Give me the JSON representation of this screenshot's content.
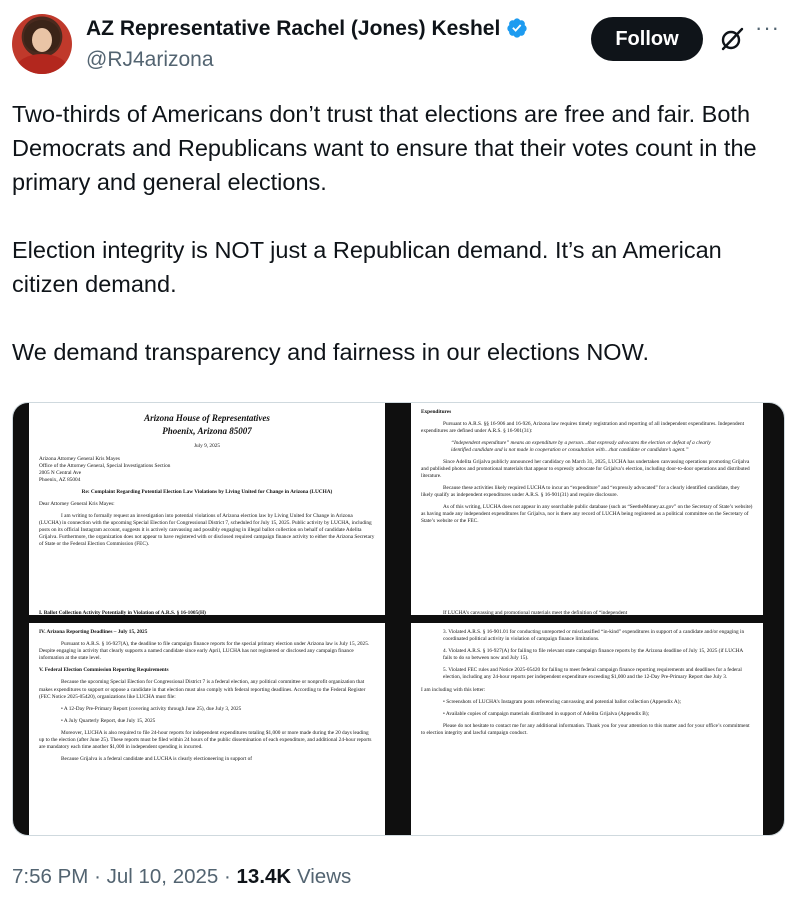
{
  "author": {
    "name": "AZ Representative Rachel (Jones) Keshel",
    "handle": "@RJ4arizona"
  },
  "actions": {
    "follow_label": "Follow"
  },
  "post": {
    "paragraphs": [
      "Two-thirds of Americans don’t trust that elections are free and fair. Both Democrats and Republicans want to ensure that their votes count in the primary and general elections.",
      "Election integrity is NOT just a Republican demand. It’s an American citizen demand.",
      "We demand transparency and fairness in our elections NOW."
    ]
  },
  "letter": {
    "p1": {
      "house": "Arizona House of Representatives",
      "city": "Phoenix, Arizona 85007",
      "date": "July 9, 2025",
      "address": [
        "Arizona Attorney General Kris Mayes",
        "Office of the Attorney General, Special Investigations Section",
        "2005 N Central Ave",
        "Phoenix, AZ 85004"
      ],
      "re": "Re: Complaint Regarding Potential Election Law Violations by Living United for Change in Arizona (LUCHA)",
      "salutation": "Dear Attorney General Kris Mayes:",
      "body": "I am writing to formally request an investigation into potential violations of Arizona election law by Living United for Change in Arizona (LUCHA) in connection with the upcoming Special Election for Congressional District 7, scheduled for July 15, 2025. Public activity by LUCHA, including posts on its official Instagram account, suggests it is actively canvassing and possibly engaging in illegal ballot collection on behalf of candidate Adelita Grijalva. Furthermore, the organization does not appear to have registered with or disclosed required campaign finance activity to either the Arizona Secretary of State or the Federal Election Commission (FEC).",
      "cut": "I. Ballot Collection Activity Potentially in Violation of A.R.S. § 16-1005(H)"
    },
    "p2": {
      "heading": "Expenditures",
      "para1": "Pursuant to A.R.S. §§ 16-906 and 16-926, Arizona law requires timely registration and reporting of all independent expenditures. Independent expenditures are defined under A.R.S. § 16-901(31):",
      "quote": "“Independent expenditure” means an expenditure by a person…that expressly advocates the election or defeat of a clearly identified candidate and is not made in cooperation or consultation with…that candidate or candidate’s agent.”",
      "para2": "Since Adelita Grijalva publicly announced her candidacy on March 31, 2025, LUCHA has undertaken canvassing operations promoting Grijalva and published photos and promotional materials that appear to expressly advocate for Grijalva’s election, including door-to-door operations and distributed literature.",
      "para3": "Because these activities likely required LUCHA to incur an “expenditure” and “expressly advocated” for a clearly identified candidate, they likely qualify as independent expenditures under A.R.S. § 16-901(31) and require disclosure.",
      "para4": "As of this writing, LUCHA does not appear in any searchable public database (such as “SeetheMoney.az.gov” on the Secretary of State’s website) as having made any independent expenditures for Grijalva, nor is there any record of LUCHA being registered as a political committee on the Secretary of State’s website or the FEC.",
      "cut": "If LUCHA’s canvassing and promotional materials meet the definition of “independent"
    },
    "p3": {
      "heading1": "IV. Arizona Reporting Deadlines – July 15, 2025",
      "para1": "Pursuant to A.R.S. § 16-927(A), the deadline to file campaign finance reports for the special primary election under Arizona law is July 15, 2025. Despite engaging in activity that clearly supports a named candidate since early April, LUCHA has not registered or disclosed any campaign finance information at the state level.",
      "heading2": "V. Federal Election Commission Reporting Requirements",
      "para2": "Because the upcoming Special Election for Congressional District 7 is a federal election, any political committee or nonprofit organization that makes expenditures to support or oppose a candidate in that election must also comply with federal reporting deadlines. According to the Federal Register (FEC Notice 2025-05420), organizations like LUCHA must file:",
      "bullet1": "A 12-Day Pre-Primary Report (covering activity through June 25), due July 3, 2025",
      "bullet2": "A July Quarterly Report, due July 15, 2025",
      "para3": "Moreover, LUCHA is also required to file 24-hour reports for independent expenditures totaling $1,000 or more made during the 20 days leading up to the election (after June 25). These reports must be filed within 24 hours of the public dissemination of each expenditure, and additional 24-hour reports are mandatory each time another $1,000 in independent spending is incurred.",
      "para4": "Because Grijalva is a federal candidate and LUCHA is clearly electioneering in support of"
    },
    "p4": {
      "item3": "3.   Violated A.R.S. § 16-901.01 for conducting unreported or misclassified “in-kind” expenditures in support of a candidate and/or engaging in coordinated political activity in violation of campaign finance limitations.",
      "item4": "4.   Violated A.R.S. § 16-927(A) for failing to file relevant state campaign finance reports by the Arizona deadline of July 15, 2025 (if LUCHA fails to do so between now and July 15).",
      "item5": "5.   Violated FEC rules and Notice 2025-05420 for failing to meet federal campaign finance reporting requirements and deadlines for a federal election, including any 24-hour reports per independent expenditure exceeding $1,000 and the 12-Day Pre-Primary Report due July 3.",
      "including": "I am including with this letter:",
      "bullet1": "Screenshots of LUCHA’s Instagram posts referencing canvassing and potential ballot collection (Appendix A);",
      "bullet2": "Available copies of campaign materials distributed in support of Adelita Grijalva (Appendix B);",
      "closing": "Please do not hesitate to contact me for any additional information. Thank you for your attention to this matter and for your office’s commitment to election integrity and lawful campaign conduct."
    }
  },
  "meta": {
    "time": "7:56 PM",
    "sep": "·",
    "date": "Jul 10, 2025",
    "views_count": "13.4K",
    "views_label": "Views"
  }
}
